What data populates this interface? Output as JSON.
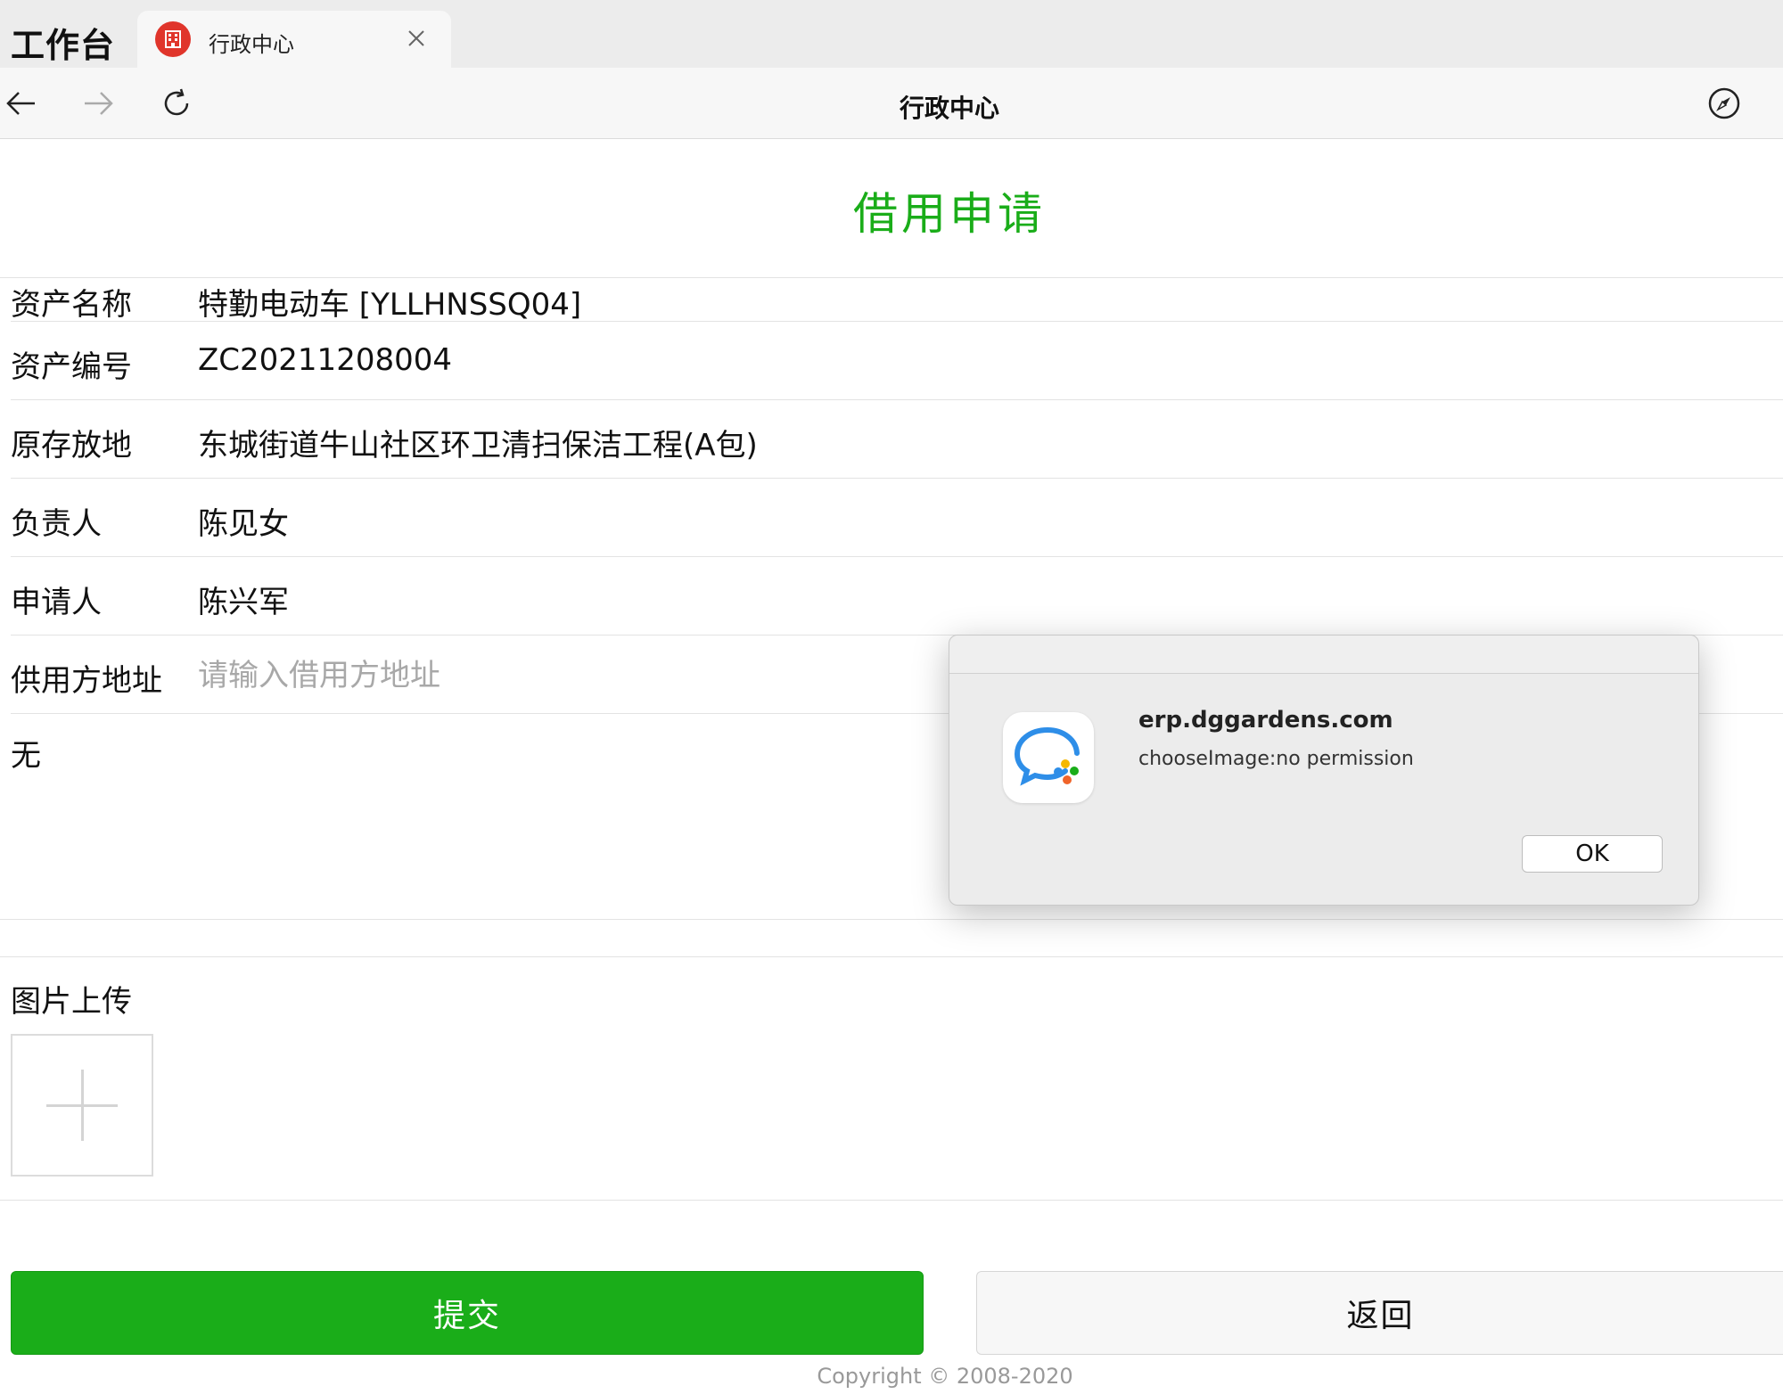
{
  "tabbar": {
    "app_title": "工作台",
    "tab_label": "行政中心"
  },
  "navbar": {
    "title": "行政中心"
  },
  "form": {
    "title": "借用申请",
    "fields": [
      {
        "label": "资产名称",
        "value": "特勤电动车 [YLLHNSSQ04]"
      },
      {
        "label": "资产编号",
        "value": "ZC20211208004"
      },
      {
        "label": "原存放地",
        "value": "东城街道牛山社区环卫清扫保洁工程(A包)"
      },
      {
        "label": "负责人",
        "value": "陈见女"
      },
      {
        "label": "申请人",
        "value": "陈兴军"
      }
    ],
    "address_label": "供用方地址",
    "address_placeholder": "请输入借用方地址",
    "remark_value": "无",
    "upload_label": "图片上传",
    "submit_label": "提交",
    "back_label": "返回",
    "copyright": "Copyright © 2008-2020"
  },
  "dialog": {
    "title": "erp.dggardens.com",
    "message": "chooseImage:no permission",
    "ok_label": "OK"
  },
  "colors": {
    "accent_green": "#1aad19",
    "tab_icon_red": "#e0352b"
  }
}
